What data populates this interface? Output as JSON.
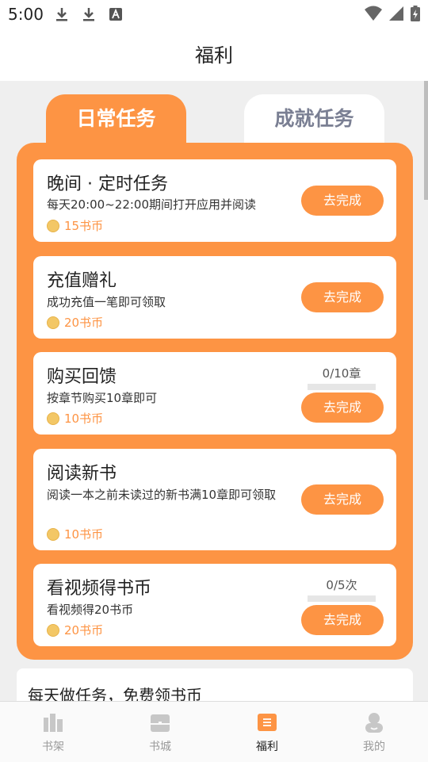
{
  "status_bar": {
    "time": "5:00"
  },
  "app_bar": {
    "title": "福利"
  },
  "tabs": [
    {
      "label": "日常任务",
      "active": true
    },
    {
      "label": "成就任务",
      "active": false
    }
  ],
  "tasks": [
    {
      "title": "晚间 · 定时任务",
      "desc": "每天20:00~22:00期间打开应用并阅读",
      "reward": "15书币",
      "button": "去完成"
    },
    {
      "title": "充值赠礼",
      "desc": "成功充值一笔即可领取",
      "reward": "20书币",
      "button": "去完成"
    },
    {
      "title": "购买回馈",
      "desc": "按章节购买10章即可",
      "reward": "10书币",
      "button": "去完成",
      "progress_text": "0/10章",
      "progress": 0
    },
    {
      "title": "阅读新书",
      "desc": "阅读一本之前未读过的新书满10章即可领取",
      "reward": "10书币",
      "button": "去完成"
    },
    {
      "title": "看视频得书币",
      "desc": "看视频得20书币",
      "reward": "20书币",
      "button": "去完成",
      "progress_text": "0/5次",
      "progress": 0
    }
  ],
  "footer_card": {
    "text": "每天做任务，免费领书币"
  },
  "bottom_nav": [
    {
      "label": "书架",
      "icon": "bookshelf-icon",
      "active": false
    },
    {
      "label": "书城",
      "icon": "bookstore-icon",
      "active": false
    },
    {
      "label": "福利",
      "icon": "benefits-icon",
      "active": true
    },
    {
      "label": "我的",
      "icon": "profile-icon",
      "active": false
    }
  ],
  "colors": {
    "accent": "#fd9444",
    "inactive_tab_text": "#7a7f93",
    "coin": "#f3c766"
  }
}
